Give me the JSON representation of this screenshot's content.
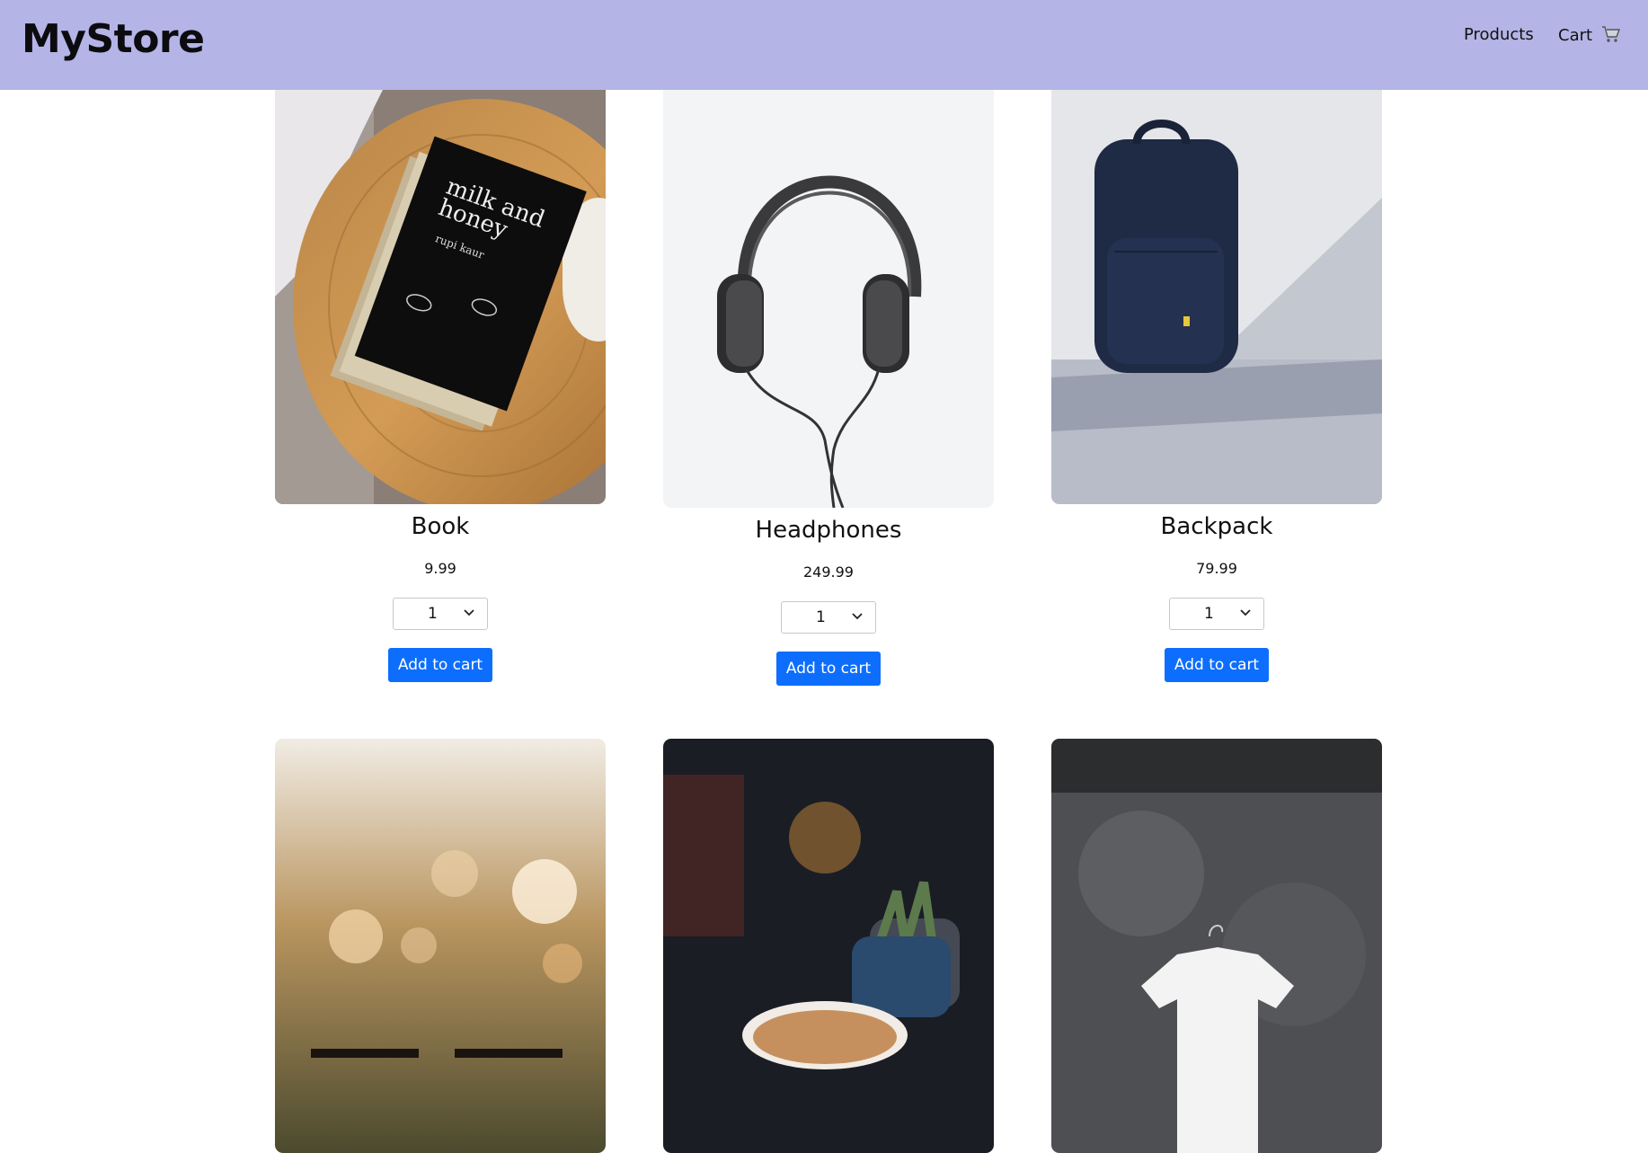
{
  "header": {
    "brand": "MyStore",
    "nav": {
      "products": "Products",
      "cart": "Cart"
    },
    "cart_icon": "shopping-cart-icon",
    "background": "#b4b5e6"
  },
  "products": [
    {
      "name": "Book",
      "price": "9.99",
      "qty": "1",
      "button": "Add to cart",
      "image": "book-image"
    },
    {
      "name": "Headphones",
      "price": "249.99",
      "qty": "1",
      "button": "Add to cart",
      "image": "headphones-image"
    },
    {
      "name": "Backpack",
      "price": "79.99",
      "qty": "1",
      "button": "Add to cart",
      "image": "backpack-image"
    },
    {
      "image": "glasses-image"
    },
    {
      "image": "coffee-image"
    },
    {
      "image": "tshirt-image"
    }
  ],
  "accent_color": "#0d6efd",
  "book_cover": {
    "title_line1": "milk and",
    "title_line2": "honey",
    "author": "rupi kaur"
  }
}
